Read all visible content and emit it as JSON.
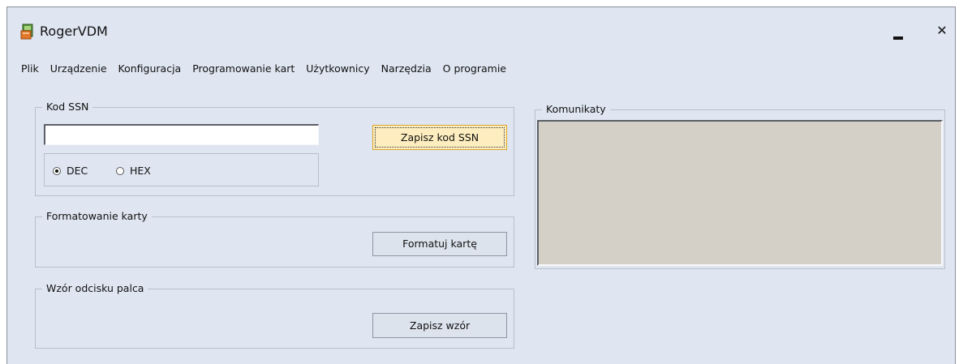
{
  "window": {
    "title": "RogerVDM",
    "icon": "rogervdm-app-icon",
    "minimize_icon": "minimize-icon",
    "close_icon": "close-icon",
    "close_glyph": "✕"
  },
  "menu": [
    {
      "label": "Plik"
    },
    {
      "label": "Urządzenie"
    },
    {
      "label": "Konfiguracja"
    },
    {
      "label": "Programowanie kart"
    },
    {
      "label": "Użytkownicy"
    },
    {
      "label": "Narzędzia"
    },
    {
      "label": "O programie"
    }
  ],
  "ssn": {
    "legend": "Kod SSN",
    "input_value": "",
    "radio_dec": "DEC",
    "radio_hex": "HEX",
    "selected": "DEC",
    "button": "Zapisz kod SSN"
  },
  "format": {
    "legend": "Formatowanie karty",
    "button": "Formatuj kartę"
  },
  "fingerprint": {
    "legend": "Wzór odcisku palca",
    "button": "Zapisz wzór"
  },
  "messages": {
    "legend": "Komunikaty"
  },
  "colors": {
    "window_bg": "#dfe6f1",
    "focused_button_bg": "#fdedbf",
    "messages_bg": "#d4d0c8"
  }
}
